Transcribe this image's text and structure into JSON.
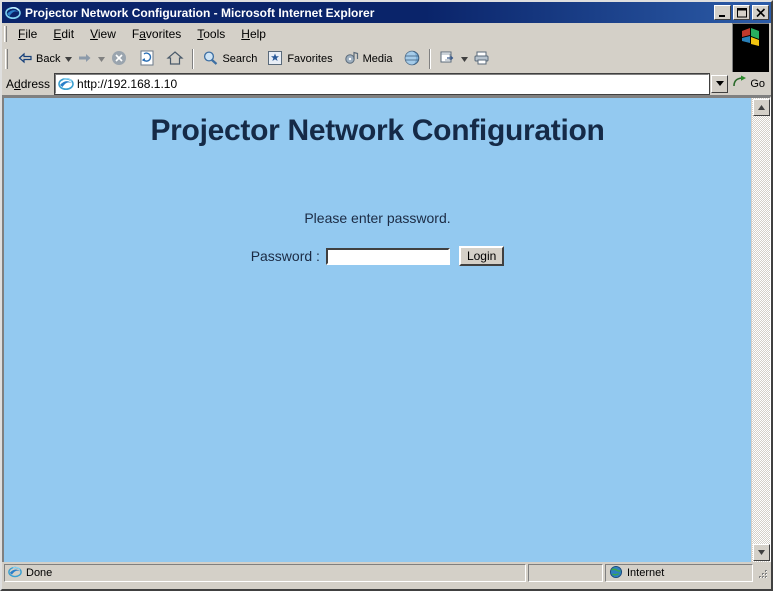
{
  "window": {
    "title": "Projector Network Configuration - Microsoft Internet Explorer",
    "title_icon": "ie-document-icon",
    "minimize_label": "Minimize",
    "maximize_label": "Maximize",
    "close_label": "Close"
  },
  "menubar": {
    "items": [
      {
        "pre": "",
        "accel": "F",
        "post": "ile"
      },
      {
        "pre": "",
        "accel": "E",
        "post": "dit"
      },
      {
        "pre": "",
        "accel": "V",
        "post": "iew"
      },
      {
        "pre": "F",
        "accel": "a",
        "post": "vorites"
      },
      {
        "pre": "",
        "accel": "T",
        "post": "ools"
      },
      {
        "pre": "",
        "accel": "H",
        "post": "elp"
      }
    ]
  },
  "toolbar": {
    "back_label": "Back",
    "forward_label": "Forward",
    "stop_label": "Stop",
    "refresh_label": "Refresh",
    "home_label": "Home",
    "search_label": "Search",
    "favorites_label": "Favorites",
    "media_label": "Media",
    "history_label": "History",
    "mail_label": "Mail",
    "print_label": "Print"
  },
  "address": {
    "label_pre": "A",
    "label_accel": "d",
    "label_post": "dress",
    "value": "http://192.168.1.10",
    "placeholder": "",
    "go_label": "Go"
  },
  "page": {
    "title": "Projector Network Configuration",
    "prompt": "Please enter password.",
    "password_label": "Password :",
    "password_value": "",
    "password_placeholder": "",
    "login_label": "Login",
    "background_color": "#93c9f0",
    "title_color": "#152a47"
  },
  "scrollbar": {
    "up_label": "Scroll up",
    "down_label": "Scroll down"
  },
  "statusbar": {
    "status": "Done",
    "middle": "",
    "zone": "Internet",
    "zone_icon": "globe-icon"
  }
}
